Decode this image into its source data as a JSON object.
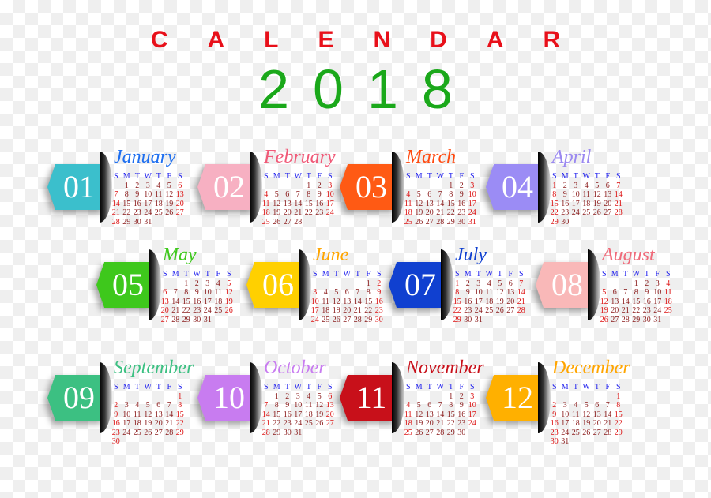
{
  "title": "CALENDAR",
  "title_color": "#e8101a",
  "year": "2018",
  "year_color": "#1aa81a",
  "weekdays": [
    "S",
    "M",
    "T",
    "W",
    "T",
    "F",
    "S"
  ],
  "months": [
    {
      "num": "01",
      "name": "January",
      "tab_color": "#3bbfcc",
      "name_color": "#1e6ff0",
      "weeks": [
        [
          null,
          1,
          2,
          3,
          4,
          5,
          6
        ],
        [
          7,
          8,
          9,
          10,
          11,
          12,
          13
        ],
        [
          14,
          15,
          16,
          17,
          18,
          19,
          20
        ],
        [
          21,
          22,
          23,
          24,
          25,
          26,
          27
        ],
        [
          28,
          29,
          30,
          31
        ]
      ]
    },
    {
      "num": "02",
      "name": "February",
      "tab_color": "#f7b0c2",
      "name_color": "#f05a78",
      "weeks": [
        [
          null,
          null,
          null,
          null,
          1,
          2,
          3
        ],
        [
          4,
          5,
          6,
          7,
          8,
          9,
          10
        ],
        [
          11,
          12,
          13,
          14,
          15,
          16,
          17
        ],
        [
          18,
          19,
          20,
          21,
          22,
          23,
          24
        ],
        [
          25,
          26,
          27,
          28
        ]
      ]
    },
    {
      "num": "03",
      "name": "March",
      "tab_color": "#ff5a14",
      "name_color": "#ff4a10",
      "weeks": [
        [
          null,
          null,
          null,
          null,
          1,
          2,
          3
        ],
        [
          4,
          5,
          6,
          7,
          8,
          9,
          10
        ],
        [
          11,
          12,
          13,
          14,
          15,
          16,
          17
        ],
        [
          18,
          19,
          20,
          21,
          22,
          23,
          24
        ],
        [
          25,
          26,
          27,
          28,
          29,
          30,
          31
        ]
      ]
    },
    {
      "num": "04",
      "name": "April",
      "tab_color": "#9b8cf5",
      "name_color": "#9a88f0",
      "weeks": [
        [
          1,
          2,
          3,
          4,
          5,
          6,
          7
        ],
        [
          8,
          9,
          10,
          11,
          12,
          13,
          14
        ],
        [
          15,
          16,
          17,
          18,
          19,
          20,
          21
        ],
        [
          22,
          23,
          24,
          25,
          26,
          27,
          28
        ],
        [
          29,
          30
        ]
      ]
    },
    {
      "num": "05",
      "name": "May",
      "tab_color": "#3ec81c",
      "name_color": "#3ec81c",
      "weeks": [
        [
          null,
          null,
          1,
          2,
          3,
          4,
          5
        ],
        [
          6,
          7,
          8,
          9,
          10,
          11,
          12
        ],
        [
          13,
          14,
          15,
          16,
          17,
          18,
          19
        ],
        [
          20,
          21,
          22,
          23,
          24,
          25,
          26
        ],
        [
          27,
          28,
          29,
          30,
          31
        ]
      ]
    },
    {
      "num": "06",
      "name": "June",
      "tab_color": "#ffd000",
      "name_color": "#ffa500",
      "weeks": [
        [
          null,
          null,
          null,
          null,
          null,
          1,
          2
        ],
        [
          3,
          4,
          5,
          6,
          7,
          8,
          9
        ],
        [
          10,
          11,
          12,
          13,
          14,
          15,
          16
        ],
        [
          17,
          18,
          19,
          20,
          21,
          22,
          23
        ],
        [
          24,
          25,
          26,
          27,
          28,
          29,
          30
        ]
      ]
    },
    {
      "num": "07",
      "name": "July",
      "tab_color": "#1040d0",
      "name_color": "#1040d0",
      "weeks": [
        [
          1,
          2,
          3,
          4,
          5,
          6,
          7
        ],
        [
          8,
          9,
          10,
          11,
          12,
          13,
          14
        ],
        [
          15,
          16,
          17,
          18,
          19,
          20,
          21
        ],
        [
          22,
          23,
          24,
          25,
          26,
          27,
          28
        ],
        [
          29,
          30,
          31
        ]
      ]
    },
    {
      "num": "08",
      "name": "August",
      "tab_color": "#f9b8b8",
      "name_color": "#f06b7a",
      "weeks": [
        [
          null,
          null,
          null,
          1,
          2,
          3,
          4
        ],
        [
          5,
          6,
          7,
          8,
          9,
          10,
          11
        ],
        [
          12,
          13,
          14,
          15,
          16,
          17,
          18
        ],
        [
          19,
          20,
          21,
          22,
          23,
          24,
          25
        ],
        [
          26,
          27,
          28,
          29,
          30,
          31
        ]
      ]
    },
    {
      "num": "09",
      "name": "September",
      "tab_color": "#3cc082",
      "name_color": "#3cc082",
      "weeks": [
        [
          null,
          null,
          null,
          null,
          null,
          null,
          1
        ],
        [
          2,
          3,
          4,
          5,
          6,
          7,
          8
        ],
        [
          9,
          10,
          11,
          12,
          13,
          14,
          15
        ],
        [
          16,
          17,
          18,
          19,
          20,
          21,
          22
        ],
        [
          23,
          24,
          25,
          26,
          27,
          28,
          29
        ],
        [
          30
        ]
      ]
    },
    {
      "num": "10",
      "name": "October",
      "tab_color": "#c87cf0",
      "name_color": "#c87cf0",
      "weeks": [
        [
          null,
          1,
          2,
          3,
          4,
          5,
          6
        ],
        [
          7,
          8,
          9,
          10,
          11,
          12,
          13
        ],
        [
          14,
          15,
          16,
          17,
          18,
          19,
          20
        ],
        [
          21,
          22,
          23,
          24,
          25,
          26,
          27
        ],
        [
          28,
          29,
          30,
          31
        ]
      ]
    },
    {
      "num": "11",
      "name": "November",
      "tab_color": "#c8101a",
      "name_color": "#c8101a",
      "weeks": [
        [
          null,
          null,
          null,
          null,
          1,
          2,
          3
        ],
        [
          4,
          5,
          6,
          7,
          8,
          9,
          10
        ],
        [
          11,
          12,
          13,
          14,
          15,
          16,
          17
        ],
        [
          18,
          19,
          20,
          21,
          22,
          23,
          24
        ],
        [
          25,
          26,
          27,
          28,
          29,
          30
        ]
      ]
    },
    {
      "num": "12",
      "name": "December",
      "tab_color": "#ffb000",
      "name_color": "#ffa500",
      "weeks": [
        [
          null,
          null,
          null,
          null,
          null,
          null,
          1
        ],
        [
          2,
          3,
          4,
          5,
          6,
          7,
          8
        ],
        [
          9,
          10,
          11,
          12,
          13,
          14,
          15
        ],
        [
          16,
          17,
          18,
          19,
          20,
          21,
          22
        ],
        [
          23,
          24,
          25,
          26,
          27,
          28,
          29
        ],
        [
          30,
          31
        ]
      ]
    }
  ]
}
